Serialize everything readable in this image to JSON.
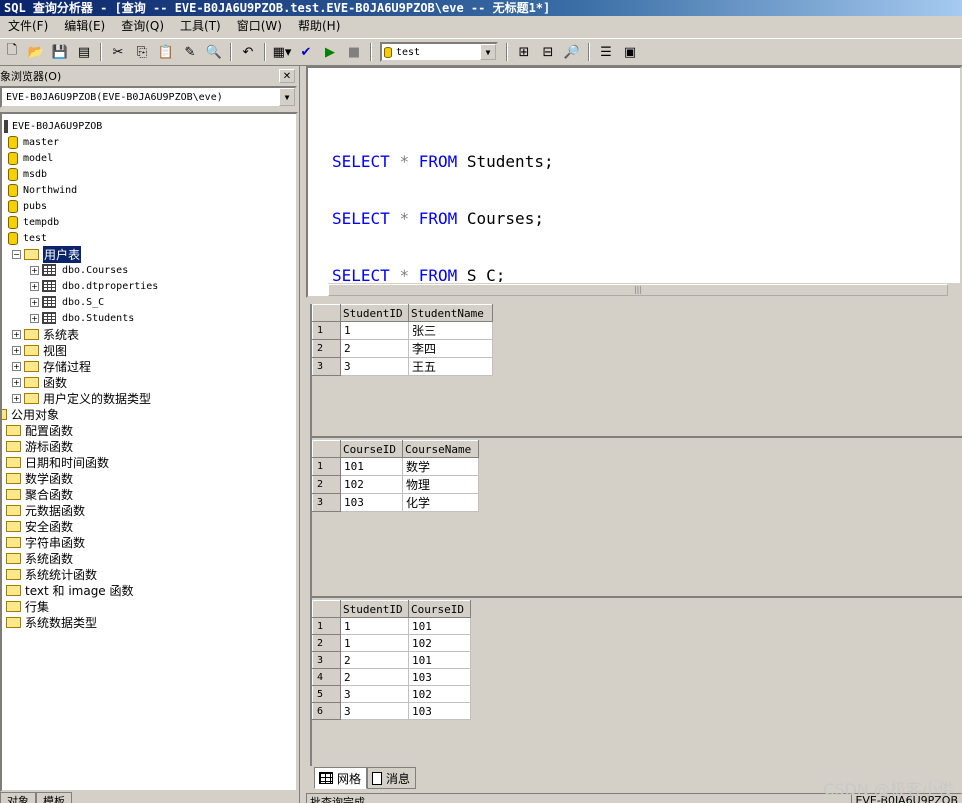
{
  "window": {
    "title": "SQL 查询分析器 - [查询 -- EVE-B0JA6U9PZOB.test.EVE-B0JA6U9PZOB\\eve -- 无标题1*]"
  },
  "menu": [
    "文件(F)",
    "编辑(E)",
    "查询(Q)",
    "工具(T)",
    "窗口(W)",
    "帮助(H)"
  ],
  "toolbar": {
    "database": "test"
  },
  "object_browser": {
    "title": "象浏览器(O)",
    "server_combo": "EVE-B0JA6U9PZOB(EVE-B0JA6U9PZOB\\eve)",
    "server": "EVE-B0JA6U9PZOB",
    "databases": [
      "master",
      "model",
      "msdb",
      "Northwind",
      "pubs",
      "tempdb",
      "test"
    ],
    "user_tables_folder": "用户表",
    "tables": [
      "dbo.Courses",
      "dbo.dtproperties",
      "dbo.S_C",
      "dbo.Students"
    ],
    "test_folders": [
      "系统表",
      "视图",
      "存储过程",
      "函数",
      "用户定义的数据类型"
    ],
    "common_objects": "公用对象",
    "common_folders": [
      "配置函数",
      "游标函数",
      "日期和时间函数",
      "数学函数",
      "聚合函数",
      "元数据函数",
      "安全函数",
      "字符串函数",
      "系统函数",
      "系统统计函数",
      "text 和 image 函数",
      "行集",
      "系统数据类型"
    ],
    "tabs": [
      "对象",
      "模板"
    ]
  },
  "editor": {
    "lines": [
      {
        "kw1": "SELECT",
        "op": "*",
        "kw2": "FROM",
        "rest": "Students;"
      },
      {
        "kw1": "SELECT",
        "op": "*",
        "kw2": "FROM",
        "rest": "Courses;"
      },
      {
        "kw1": "SELECT",
        "op": "*",
        "kw2": "FROM",
        "rest": "S_C;"
      }
    ]
  },
  "results": {
    "students": {
      "columns": [
        "StudentID",
        "StudentName"
      ],
      "rows": [
        [
          "1",
          "张三"
        ],
        [
          "2",
          "李四"
        ],
        [
          "3",
          "王五"
        ]
      ]
    },
    "courses": {
      "columns": [
        "CourseID",
        "CourseName"
      ],
      "rows": [
        [
          "101",
          "数学"
        ],
        [
          "102",
          "物理"
        ],
        [
          "103",
          "化学"
        ]
      ]
    },
    "s_c": {
      "columns": [
        "StudentID",
        "CourseID"
      ],
      "rows": [
        [
          "1",
          "101"
        ],
        [
          "1",
          "102"
        ],
        [
          "2",
          "101"
        ],
        [
          "2",
          "103"
        ],
        [
          "3",
          "102"
        ],
        [
          "3",
          "103"
        ]
      ]
    }
  },
  "result_tabs": [
    "网格",
    "消息"
  ],
  "status": {
    "left": "批查询完成。",
    "right": "EVE-B0JA6U9PZOB"
  },
  "watermark": "CSDN @极客小俊"
}
